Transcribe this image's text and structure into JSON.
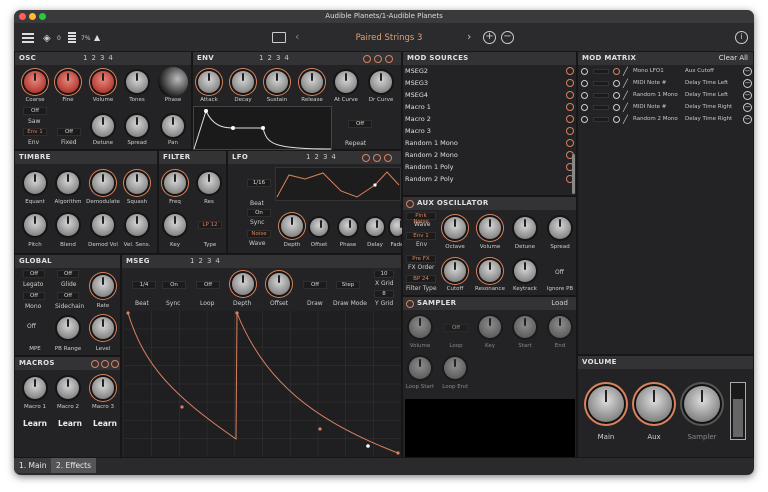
{
  "window": {
    "title": "Audible Planets/1-Audible Planets"
  },
  "toolbar": {
    "layers_count": "0",
    "cpu": "7%",
    "preset": "Paired Strings 3",
    "prev": "‹",
    "next": "›"
  },
  "osc": {
    "title": "OSC",
    "tabs": [
      "1",
      "2",
      "3",
      "4"
    ],
    "knobs": [
      "Coarse",
      "Fine",
      "Volume",
      "Tones",
      "Phase"
    ],
    "row2": [
      "Detune",
      "Spread",
      "Pan"
    ],
    "saw": "Saw",
    "off1": "Off",
    "env": "Env 1",
    "fixed": "Fixed",
    "fixed_val": "Off",
    "env_lbl": "Env"
  },
  "env": {
    "title": "ENV",
    "tabs": [
      "1",
      "2",
      "3",
      "4"
    ],
    "knobs": [
      "Attack",
      "Decay",
      "Sustain",
      "Release",
      "At Curve",
      "Dr Curve"
    ],
    "repeat": "Repeat",
    "repeat_val": "Off"
  },
  "timbre": {
    "title": "TIMBRE",
    "row1": [
      "Equant",
      "Algorithm",
      "Demodulate",
      "Squash"
    ],
    "row2": [
      "Pitch",
      "Blend",
      "Demod Vol",
      "Vel. Sens."
    ]
  },
  "filter": {
    "title": "FILTER",
    "row1": [
      "Freq",
      "Res"
    ],
    "key": "Key",
    "type": "Type",
    "type_val": "LP 12"
  },
  "lfo": {
    "title": "LFO",
    "tabs": [
      "1",
      "2",
      "3",
      "4"
    ],
    "rate": "1/16",
    "beat": "Beat",
    "sync_val": "On",
    "sync": "Sync",
    "wave_val": "Noise",
    "wave": "Wave",
    "knobs": [
      "Depth",
      "Offset",
      "Phase",
      "Delay",
      "Fade"
    ]
  },
  "global": {
    "title": "GLOBAL",
    "legato": "Legato",
    "legato_val": "Off",
    "glide": "Glide",
    "glide_val": "Off",
    "mono": "Mono",
    "mono_val": "Off",
    "sidechain": "Sidechain",
    "sidechain_val": "Off",
    "rate": "Rate",
    "mpe": "MPE",
    "mpe_val": "Off",
    "pb": "PB Range",
    "level": "Level"
  },
  "mseg": {
    "title": "MSEG",
    "tabs": [
      "1",
      "2",
      "3",
      "4"
    ],
    "beat": "Beat",
    "beat_val": "1/4",
    "sync": "Sync",
    "sync_val": "On",
    "loop": "Loop",
    "loop_val": "Off",
    "depth": "Depth",
    "offset": "Offset",
    "draw": "Draw",
    "draw_val": "Off",
    "drawmode": "Draw Mode",
    "drawmode_val": "Step",
    "xgrid": "X Grid",
    "xgrid_val": "10",
    "ygrid": "Y Grid",
    "ygrid_val": "8"
  },
  "macros": {
    "title": "MACROS",
    "knobs": [
      "Macro 1",
      "Macro 2",
      "Macro 3"
    ],
    "learn": "Learn"
  },
  "modsrc": {
    "title": "MOD SOURCES",
    "items": [
      "MSEG2",
      "MSEG3",
      "MSEG4",
      "Macro 1",
      "Macro 2",
      "Macro 3",
      "Random 1 Mono",
      "Random 2 Mono",
      "Random 1 Poly",
      "Random 2 Poly"
    ]
  },
  "modmatrix": {
    "title": "MOD MATRIX",
    "clear": "Clear All",
    "rows": [
      {
        "src": "Mono LFO1",
        "dst": "Aux Cutoff"
      },
      {
        "src": "MIDI Note #",
        "dst": "Delay Time Left"
      },
      {
        "src": "Random 1 Mono",
        "dst": "Delay Time Left"
      },
      {
        "src": "MIDI Note #",
        "dst": "Delay Time Right"
      },
      {
        "src": "Random 2 Mono",
        "dst": "Delay Time Right"
      }
    ]
  },
  "aux": {
    "title": "AUX OSCILLATOR",
    "wave_val": "Pink Noise",
    "wave": "Wave",
    "env_val": "Env 1",
    "env": "Env",
    "fxorder_val": "Pre FX",
    "fxorder": "FX Order",
    "ftype_val": "BP 24",
    "ftype": "Filter Type",
    "knobs": [
      "Octave",
      "Volume",
      "Detune",
      "Spread"
    ],
    "row2": [
      "Cutoff",
      "Resonance",
      "Keytrack",
      "Ignore PB"
    ],
    "ignore_val": "Off"
  },
  "sampler": {
    "title": "SAMPLER",
    "load": "Load",
    "knobs": [
      "Volume",
      "Loop",
      "Key",
      "Start",
      "End"
    ],
    "loop_val": "Off",
    "row2": [
      "Loop Start",
      "Loop End"
    ]
  },
  "volume": {
    "title": "VOLUME",
    "knobs": [
      "Main",
      "Aux",
      "Sampler"
    ]
  },
  "tabs": {
    "main": "1. Main",
    "effects": "2. Effects"
  },
  "colors": {
    "accent": "#d9825d",
    "bg": "#232325"
  }
}
